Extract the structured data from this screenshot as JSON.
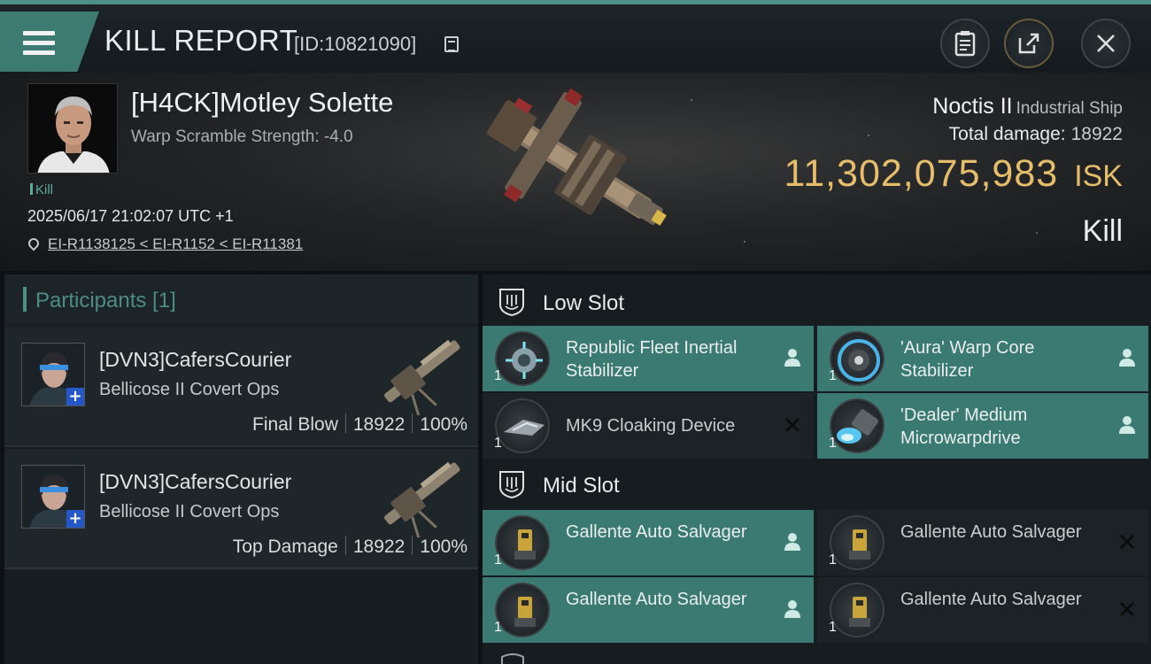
{
  "header": {
    "title": "KILL REPORT",
    "report_id": "[ID:10821090]"
  },
  "victim": {
    "name": "[H4CK]Motley Solette",
    "warp_scramble": "Warp Scramble Strength: -4.0",
    "kill_tag": "Kill",
    "datetime": "2025/06/17 21:02:07 UTC +1",
    "location": "EI-R1138125 < EI-R1152 < EI-R11381",
    "ship_name": "Noctis II",
    "ship_class": "Industrial Ship",
    "total_damage_label": "Total damage:",
    "total_damage": "18922",
    "isk_value": "11,302,075,983",
    "isk_unit": "ISK",
    "result": "Kill"
  },
  "participants": {
    "label": "Participants [1]",
    "rows": [
      {
        "name": "[DVN3]CafersCourier",
        "ship": "Bellicose II Covert Ops",
        "role": "Final Blow",
        "damage": "18922",
        "percent": "100%"
      },
      {
        "name": "[DVN3]CafersCourier",
        "ship": "Bellicose II Covert Ops",
        "role": "Top Damage",
        "damage": "18922",
        "percent": "100%"
      }
    ]
  },
  "slots": {
    "low": {
      "label": "Low Slot",
      "modules": [
        {
          "name": "Republic Fleet Inertial Stabilizer",
          "qty": "1",
          "status": "dropped"
        },
        {
          "name": "'Aura' Warp Core Stabilizer",
          "qty": "1",
          "status": "dropped"
        },
        {
          "name": "MK9 Cloaking Device",
          "qty": "1",
          "status": "destroyed"
        },
        {
          "name": "'Dealer' Medium Microwarpdrive",
          "qty": "1",
          "status": "dropped"
        }
      ]
    },
    "mid": {
      "label": "Mid Slot",
      "modules": [
        {
          "name": "Gallente Auto Salvager",
          "qty": "1",
          "status": "dropped"
        },
        {
          "name": "Gallente Auto Salvager",
          "qty": "1",
          "status": "destroyed"
        },
        {
          "name": "Gallente Auto Salvager",
          "qty": "1",
          "status": "dropped"
        },
        {
          "name": "Gallente Auto Salvager",
          "qty": "1",
          "status": "destroyed"
        }
      ]
    }
  },
  "colors": {
    "accent": "#4f8f86",
    "isk": "#e6bd6b",
    "dropped_bg": "#3b7a72",
    "destroyed_bg": "#1c2326"
  },
  "icons": {
    "menu": "hamburger-icon",
    "copy": "copy-icon",
    "clipboard": "clipboard-icon",
    "share": "share-icon",
    "close": "close-icon",
    "pin": "location-pin-icon",
    "slot": "slot-shield-icon",
    "dropped": "person-icon",
    "destroyed": "x-icon"
  }
}
